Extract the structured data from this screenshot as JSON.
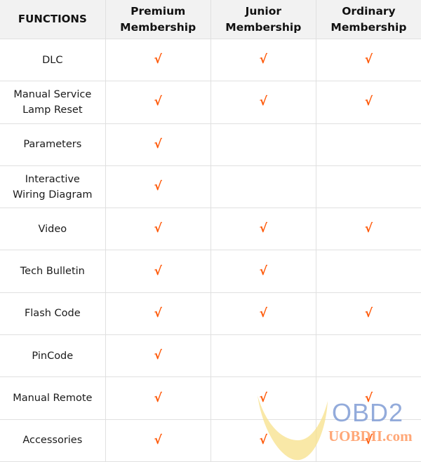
{
  "table": {
    "headers": [
      "FUNCTIONS",
      "Premium\nMembership",
      "Junior\nMembership",
      "Ordinary\nMembership"
    ],
    "check_symbol": "√",
    "check_color": "#ff5a0a",
    "rows": [
      {
        "function": "DLC",
        "premium": "√",
        "junior": "√",
        "ordinary": "√"
      },
      {
        "function": "Manual Service Lamp Reset",
        "premium": "√",
        "junior": "√",
        "ordinary": "√"
      },
      {
        "function": "Parameters",
        "premium": "√",
        "junior": "",
        "ordinary": ""
      },
      {
        "function": "Interactive Wiring Diagram",
        "premium": "√",
        "junior": "",
        "ordinary": ""
      },
      {
        "function": "Video",
        "premium": "√",
        "junior": "√",
        "ordinary": "√"
      },
      {
        "function": "Tech Bulletin",
        "premium": "√",
        "junior": "√",
        "ordinary": ""
      },
      {
        "function": "Flash Code",
        "premium": "√",
        "junior": "√",
        "ordinary": "√"
      },
      {
        "function": "PinCode",
        "premium": "√",
        "junior": "",
        "ordinary": ""
      },
      {
        "function": "Manual Remote",
        "premium": "√",
        "junior": "√",
        "ordinary": "√"
      },
      {
        "function": "Accessories",
        "premium": "√",
        "junior": "√",
        "ordinary": "√"
      }
    ]
  },
  "watermark": {
    "logo_text": "OBD2",
    "url_text": "UOBDII.com"
  }
}
